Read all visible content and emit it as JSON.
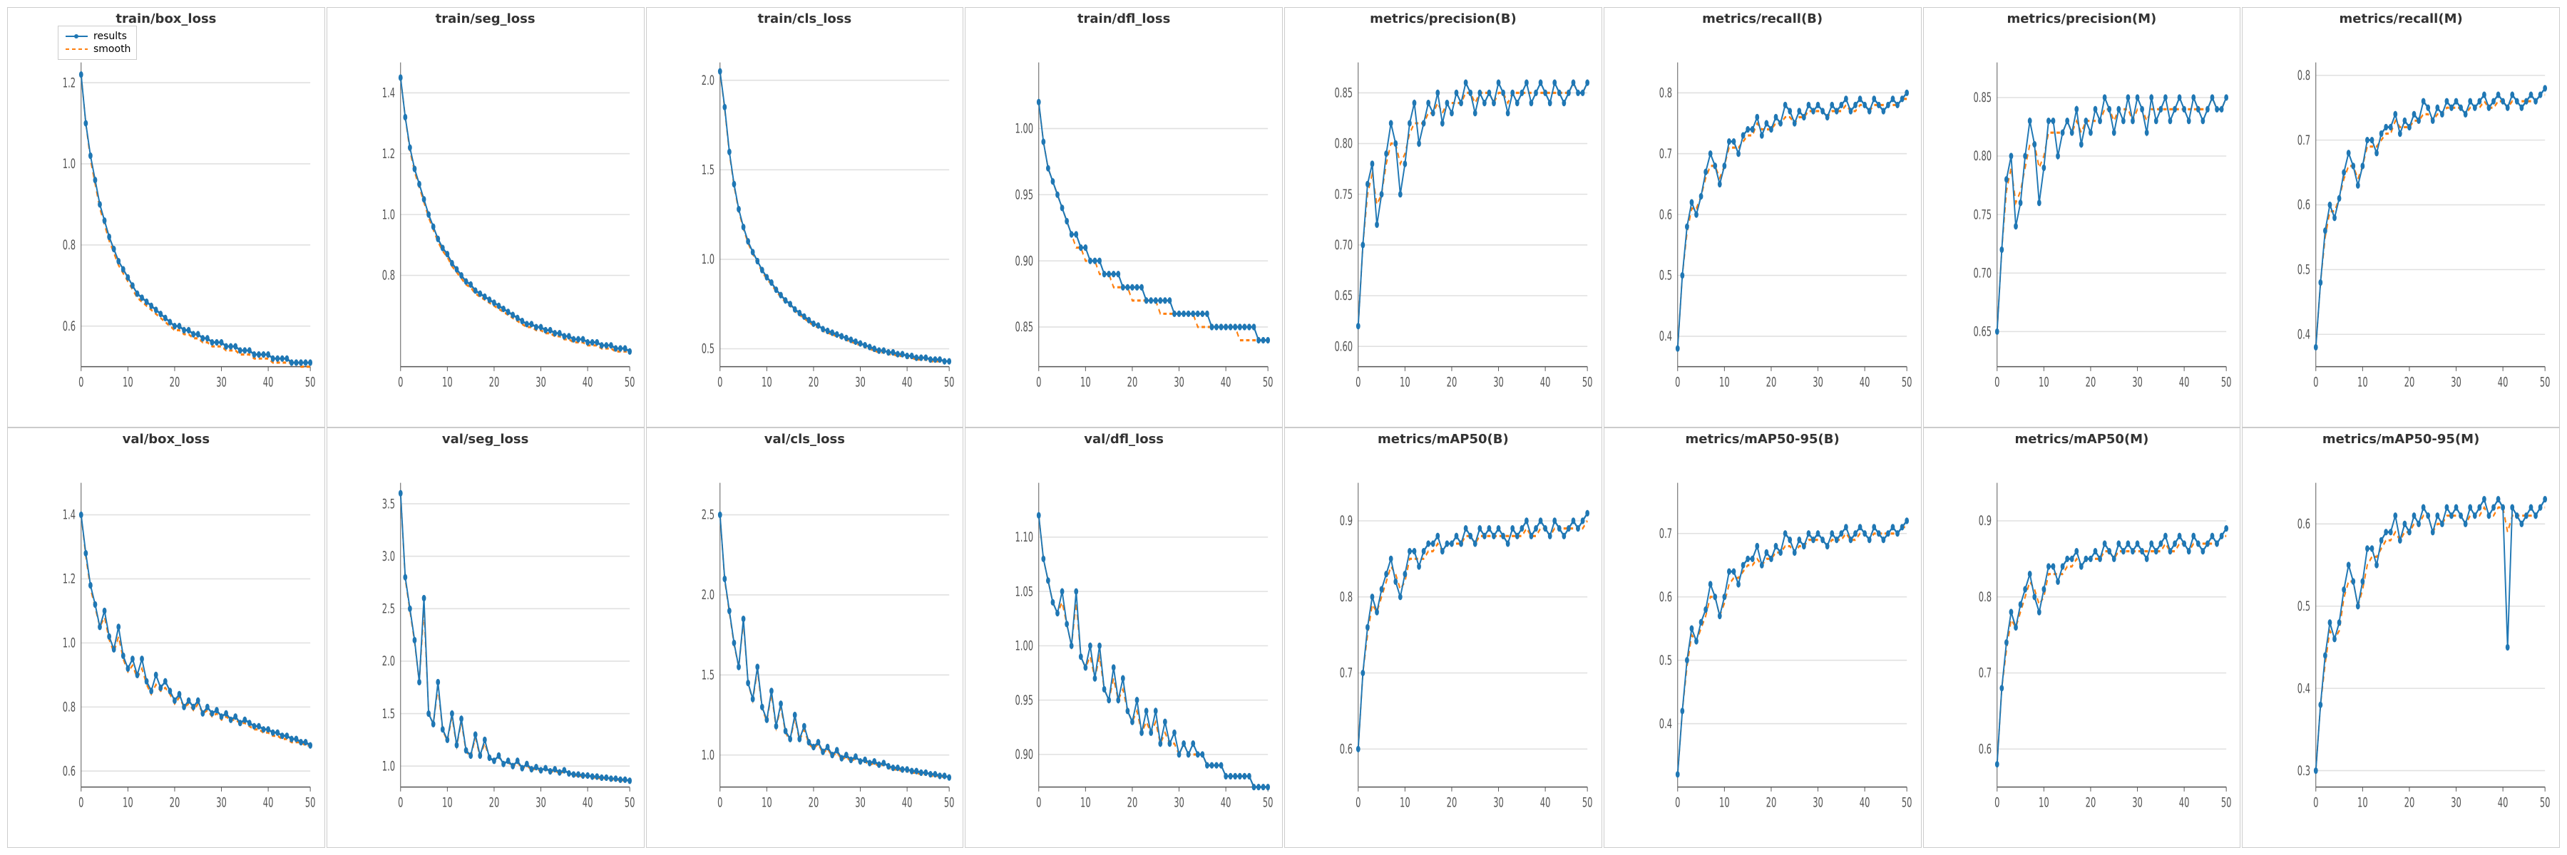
{
  "charts": {
    "row1": [
      {
        "title": "train/box_loss",
        "id": "train_box_loss",
        "ymin": 0.5,
        "ymax": 1.25,
        "yticks": [
          "1.2",
          "1.0",
          "0.8",
          "0.6"
        ],
        "hasLegend": true
      },
      {
        "title": "train/seg_loss",
        "id": "train_seg_loss",
        "ymin": 0.5,
        "ymax": 1.5,
        "yticks": [
          "1.4",
          "1.2",
          "1.0",
          "0.8"
        ],
        "hasLegend": false
      },
      {
        "title": "train/cls_loss",
        "id": "train_cls_loss",
        "ymin": 0.4,
        "ymax": 2.1,
        "yticks": [
          "2.0",
          "1.5",
          "1.0",
          "0.5"
        ],
        "hasLegend": false
      },
      {
        "title": "train/dfl_loss",
        "id": "train_dfl_loss",
        "ymin": 0.82,
        "ymax": 1.05,
        "yticks": [
          "1.00",
          "0.95",
          "0.90",
          "0.85"
        ],
        "hasLegend": false
      },
      {
        "title": "metrics/precision(B)",
        "id": "metrics_prec_b",
        "ymin": 0.58,
        "ymax": 0.88,
        "yticks": [
          "0.85",
          "0.80",
          "0.75",
          "0.70",
          "0.65",
          "0.60"
        ],
        "hasLegend": false
      },
      {
        "title": "metrics/recall(B)",
        "id": "metrics_rec_b",
        "ymin": 0.35,
        "ymax": 0.85,
        "yticks": [
          "0.8",
          "0.7",
          "0.6",
          "0.5",
          "0.4"
        ],
        "hasLegend": false
      },
      {
        "title": "metrics/precision(M)",
        "id": "metrics_prec_m",
        "ymin": 0.62,
        "ymax": 0.88,
        "yticks": [
          "0.85",
          "0.80",
          "0.75",
          "0.70",
          "0.65"
        ],
        "hasLegend": false
      },
      {
        "title": "metrics/recall(M)",
        "id": "metrics_rec_m",
        "ymin": 0.35,
        "ymax": 0.82,
        "yticks": [
          "0.8",
          "0.7",
          "0.6",
          "0.5",
          "0.4"
        ],
        "hasLegend": false
      }
    ],
    "row2": [
      {
        "title": "val/box_loss",
        "id": "val_box_loss",
        "ymin": 0.55,
        "ymax": 1.5,
        "yticks": [
          "1.4",
          "1.2",
          "1.0",
          "0.8",
          "0.6"
        ],
        "hasLegend": false
      },
      {
        "title": "val/seg_loss",
        "id": "val_seg_loss",
        "ymin": 0.8,
        "ymax": 3.7,
        "yticks": [
          "3.5",
          "3.0",
          "2.5",
          "2.0",
          "1.5",
          "1.0"
        ],
        "hasLegend": false
      },
      {
        "title": "val/cls_loss",
        "id": "val_cls_loss",
        "ymin": 0.8,
        "ymax": 2.7,
        "yticks": [
          "2.5",
          "2.0",
          "1.5",
          "1.0"
        ],
        "hasLegend": false
      },
      {
        "title": "val/dfl_loss",
        "id": "val_dfl_loss",
        "ymin": 0.87,
        "ymax": 1.15,
        "yticks": [
          "1.10",
          "1.05",
          "1.00",
          "0.95",
          "0.90"
        ],
        "hasLegend": false
      },
      {
        "title": "metrics/mAP50(B)",
        "id": "metrics_map50_b",
        "ymin": 0.55,
        "ymax": 0.95,
        "yticks": [
          "0.9",
          "0.8",
          "0.7",
          "0.6"
        ],
        "hasLegend": false
      },
      {
        "title": "metrics/mAP50-95(B)",
        "id": "metrics_map5095_b",
        "ymin": 0.3,
        "ymax": 0.78,
        "yticks": [
          "0.7",
          "0.6",
          "0.5",
          "0.4"
        ],
        "hasLegend": false
      },
      {
        "title": "metrics/mAP50(M)",
        "id": "metrics_map50_m",
        "ymin": 0.55,
        "ymax": 0.95,
        "yticks": [
          "0.9",
          "0.8",
          "0.7",
          "0.6"
        ],
        "hasLegend": false
      },
      {
        "title": "metrics/mAP50-95(M)",
        "id": "metrics_map5095_m",
        "ymin": 0.28,
        "ymax": 0.65,
        "yticks": [
          "0.6",
          "0.5",
          "0.4",
          "0.3"
        ],
        "hasLegend": false
      }
    ]
  },
  "legend": {
    "results_label": "results",
    "smooth_label": "smooth"
  },
  "x_ticks": [
    "0",
    "10",
    "20",
    "30",
    "40",
    "50"
  ]
}
